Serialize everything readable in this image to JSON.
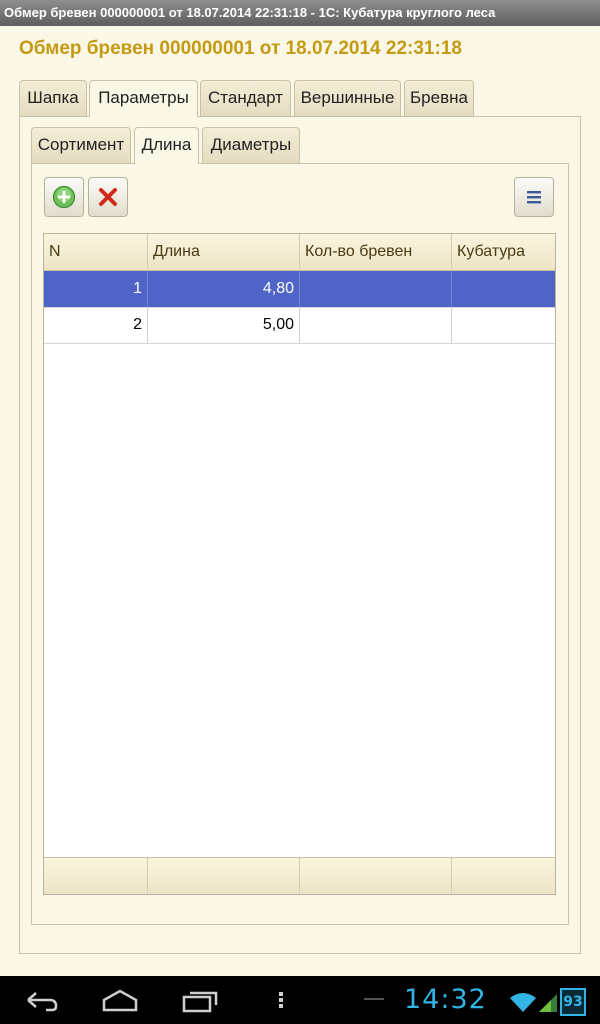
{
  "window": {
    "title": "Обмер бревен 000000001 от 18.07.2014 22:31:18 - 1С: Кубатура круглого леса"
  },
  "document": {
    "title": "Обмер бревен 000000001 от 18.07.2014 22:31:18"
  },
  "main_tabs": [
    {
      "label": "Шапка",
      "active": false
    },
    {
      "label": "Параметры",
      "active": true
    },
    {
      "label": "Стандарт",
      "active": false
    },
    {
      "label": "Вершинные",
      "active": false
    },
    {
      "label": "Бревна",
      "active": false
    }
  ],
  "sub_tabs": [
    {
      "label": "Сортимент",
      "active": false
    },
    {
      "label": "Длина",
      "active": true
    },
    {
      "label": "Диаметры",
      "active": false
    }
  ],
  "toolbar": {
    "add_icon": "plus-circle-icon",
    "delete_icon": "red-x-icon",
    "menu_icon": "menu-lines-icon"
  },
  "table": {
    "columns": [
      "N",
      "Длина",
      "Кол-во бревен",
      "Кубатура"
    ],
    "rows": [
      {
        "n": "1",
        "length": "4,80",
        "count": "",
        "volume": "",
        "selected": true
      },
      {
        "n": "2",
        "length": "5,00",
        "count": "",
        "volume": "",
        "selected": false
      }
    ]
  },
  "statusbar": {
    "clock": "14:32",
    "battery": "93",
    "icons": [
      "back-icon",
      "home-icon",
      "recent-apps-icon",
      "overflow-menu-icon",
      "wifi-icon",
      "signal-icon",
      "battery-icon"
    ]
  },
  "colors": {
    "title_accent": "#c49a12",
    "selected_row": "#4f64c6",
    "clock": "#32b5e5"
  }
}
